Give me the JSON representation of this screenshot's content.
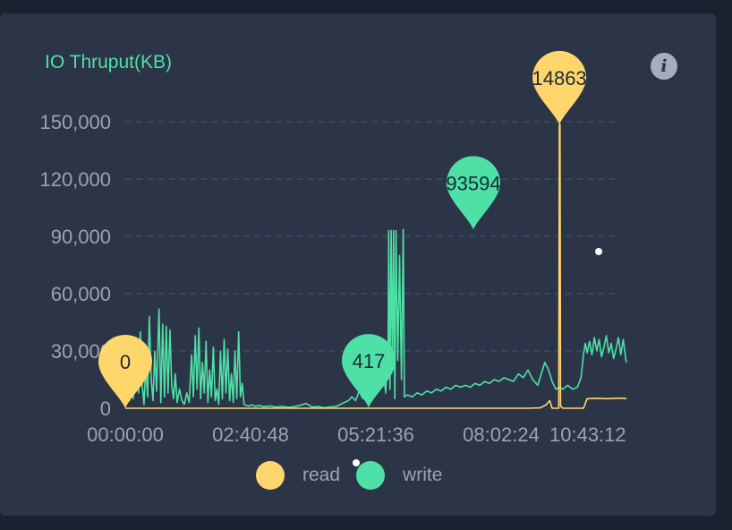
{
  "card": {
    "title": "IO Thruput(KB)",
    "info_icon": "info-circle-icon"
  },
  "colors": {
    "background": "#1c2130",
    "card": "#2c3547",
    "read": "#ffd66b",
    "write": "#4ee0a6",
    "grid": "#3c5270",
    "axis_text": "#9aa3b3"
  },
  "chart_data": {
    "type": "line",
    "title": "IO Thruput(KB)",
    "xlabel": "",
    "ylabel": "",
    "ylim": [
      0,
      150000
    ],
    "y_ticks": [
      0,
      30000,
      60000,
      90000,
      120000,
      150000
    ],
    "y_tick_labels": [
      "0",
      "30,000",
      "60,000",
      "90,000",
      "120,000",
      "150,000"
    ],
    "x_ticks": [
      "00:00:00",
      "02:40:48",
      "05:21:36",
      "08:02:24",
      "10:43:12"
    ],
    "x_range_seconds": [
      0,
      41560
    ],
    "grid": true,
    "legend_position": "bottom",
    "series": [
      {
        "name": "read",
        "color": "#ffd66b",
        "points": [
          [
            0,
            0
          ],
          [
            5000,
            0
          ],
          [
            10000,
            0
          ],
          [
            15000,
            0
          ],
          [
            20000,
            0
          ],
          [
            25000,
            0
          ],
          [
            30000,
            0
          ],
          [
            33400,
            0
          ],
          [
            34400,
            200
          ],
          [
            34900,
            1800
          ],
          [
            35200,
            4000
          ],
          [
            35400,
            0
          ],
          [
            35950,
            0
          ],
          [
            36000,
            148630
          ],
          [
            36050,
            148630
          ],
          [
            36100,
            1000
          ],
          [
            36300,
            0
          ],
          [
            38000,
            0
          ],
          [
            38300,
            5000
          ],
          [
            39000,
            5200
          ],
          [
            40000,
            5000
          ],
          [
            41000,
            5300
          ],
          [
            41560,
            5000
          ]
        ],
        "markers": [
          {
            "label": "0",
            "x": 0,
            "y": 0
          },
          {
            "label": "148630",
            "display": "14863",
            "x": 36000,
            "y": 148630
          }
        ]
      },
      {
        "name": "write",
        "color": "#4ee0a6",
        "points": [
          [
            0,
            3000
          ],
          [
            200,
            19000
          ],
          [
            350,
            4000
          ],
          [
            500,
            26000
          ],
          [
            650,
            5000
          ],
          [
            800,
            14000
          ],
          [
            950,
            35000
          ],
          [
            1100,
            8000
          ],
          [
            1250,
            40000
          ],
          [
            1400,
            12000
          ],
          [
            1550,
            2000
          ],
          [
            1700,
            22000
          ],
          [
            1850,
            6000
          ],
          [
            2000,
            48000
          ],
          [
            2150,
            15000
          ],
          [
            2300,
            4000
          ],
          [
            2450,
            30000
          ],
          [
            2600,
            9000
          ],
          [
            2800,
            52000
          ],
          [
            2950,
            3000
          ],
          [
            3100,
            44000
          ],
          [
            3250,
            6000
          ],
          [
            3400,
            43000
          ],
          [
            3550,
            8000
          ],
          [
            3700,
            41000
          ],
          [
            3850,
            12000
          ],
          [
            4000,
            5000
          ],
          [
            4150,
            18000
          ],
          [
            4300,
            3000
          ],
          [
            4500,
            10000
          ],
          [
            4700,
            4000
          ],
          [
            4900,
            2000
          ],
          [
            5100,
            8000
          ],
          [
            5300,
            3000
          ],
          [
            5500,
            28000
          ],
          [
            5650,
            6000
          ],
          [
            5800,
            38000
          ],
          [
            5950,
            10000
          ],
          [
            6100,
            42000
          ],
          [
            6250,
            5000
          ],
          [
            6400,
            24000
          ],
          [
            6550,
            8000
          ],
          [
            6700,
            35000
          ],
          [
            6850,
            3000
          ],
          [
            7000,
            20000
          ],
          [
            7150,
            6000
          ],
          [
            7300,
            32000
          ],
          [
            7450,
            4000
          ],
          [
            7600,
            10000
          ],
          [
            7750,
            2000
          ],
          [
            7900,
            30000
          ],
          [
            8050,
            5000
          ],
          [
            8200,
            36000
          ],
          [
            8350,
            8000
          ],
          [
            8500,
            31000
          ],
          [
            8650,
            4000
          ],
          [
            8800,
            18000
          ],
          [
            8950,
            3000
          ],
          [
            9100,
            30000
          ],
          [
            9250,
            5000
          ],
          [
            9400,
            40000
          ],
          [
            9550,
            6000
          ],
          [
            9700,
            13000
          ],
          [
            9850,
            2000
          ],
          [
            10000,
            1500
          ],
          [
            10300,
            1200
          ],
          [
            10500,
            1800
          ],
          [
            10800,
            1000
          ],
          [
            11100,
            1500
          ],
          [
            11500,
            800
          ],
          [
            12000,
            1200
          ],
          [
            12500,
            600
          ],
          [
            13000,
            900
          ],
          [
            13500,
            500
          ],
          [
            14000,
            800
          ],
          [
            14500,
            1500
          ],
          [
            15000,
            2500
          ],
          [
            15500,
            600
          ],
          [
            16000,
            900
          ],
          [
            16500,
            300
          ],
          [
            17000,
            700
          ],
          [
            17500,
            1000
          ],
          [
            18000,
            2500
          ],
          [
            18500,
            4000
          ],
          [
            18800,
            6000
          ],
          [
            19100,
            4000
          ],
          [
            19400,
            9000
          ],
          [
            19700,
            5000
          ],
          [
            20000,
            12000
          ],
          [
            20300,
            6000
          ],
          [
            20600,
            18000
          ],
          [
            20800,
            38000
          ],
          [
            21000,
            25000
          ],
          [
            21200,
            14000
          ],
          [
            21400,
            20000
          ],
          [
            21600,
            8000
          ],
          [
            21800,
            30000
          ],
          [
            21850,
            93000
          ],
          [
            21950,
            10000
          ],
          [
            22050,
            93000
          ],
          [
            22150,
            20000
          ],
          [
            22250,
            93000
          ],
          [
            22350,
            5000
          ],
          [
            22450,
            93000
          ],
          [
            22600,
            25000
          ],
          [
            22750,
            80000
          ],
          [
            22900,
            15000
          ],
          [
            23050,
            93594
          ],
          [
            23150,
            6000
          ],
          [
            23400,
            7000
          ],
          [
            23800,
            6000
          ],
          [
            24200,
            8000
          ],
          [
            24600,
            7000
          ],
          [
            25000,
            9000
          ],
          [
            25400,
            8000
          ],
          [
            25800,
            10000
          ],
          [
            26200,
            9000
          ],
          [
            26600,
            11000
          ],
          [
            27000,
            10000
          ],
          [
            27400,
            12000
          ],
          [
            27800,
            11000
          ],
          [
            28200,
            12000
          ],
          [
            28600,
            11000
          ],
          [
            29000,
            13000
          ],
          [
            29400,
            12000
          ],
          [
            29800,
            14000
          ],
          [
            30200,
            13000
          ],
          [
            30600,
            15000
          ],
          [
            31000,
            14000
          ],
          [
            31400,
            16000
          ],
          [
            31800,
            15000
          ],
          [
            32200,
            14000
          ],
          [
            32600,
            18000
          ],
          [
            33000,
            16000
          ],
          [
            33400,
            20000
          ],
          [
            33800,
            15000
          ],
          [
            34200,
            12000
          ],
          [
            34500,
            18000
          ],
          [
            34800,
            24000
          ],
          [
            35100,
            20000
          ],
          [
            35400,
            14000
          ],
          [
            35700,
            10000
          ],
          [
            36000,
            11000
          ],
          [
            36300,
            10000
          ],
          [
            36700,
            12000
          ],
          [
            37100,
            10000
          ],
          [
            37500,
            11000
          ],
          [
            37800,
            16000
          ],
          [
            37900,
            22000
          ],
          [
            38000,
            28000
          ],
          [
            38150,
            34000
          ],
          [
            38300,
            29000
          ],
          [
            38500,
            35000
          ],
          [
            38700,
            28000
          ],
          [
            38900,
            37000
          ],
          [
            39100,
            30000
          ],
          [
            39300,
            36000
          ],
          [
            39500,
            27000
          ],
          [
            39700,
            32000
          ],
          [
            39900,
            38000
          ],
          [
            40100,
            29000
          ],
          [
            40300,
            34000
          ],
          [
            40500,
            26000
          ],
          [
            40700,
            31000
          ],
          [
            40900,
            37000
          ],
          [
            41100,
            28000
          ],
          [
            41300,
            36000
          ],
          [
            41500,
            26000
          ],
          [
            41560,
            24000
          ]
        ],
        "markers": [
          {
            "label": "417",
            "x": 20000,
            "y": 417
          },
          {
            "label": "93594",
            "display": "93594",
            "x": 29000,
            "y": 93594
          }
        ]
      }
    ]
  }
}
